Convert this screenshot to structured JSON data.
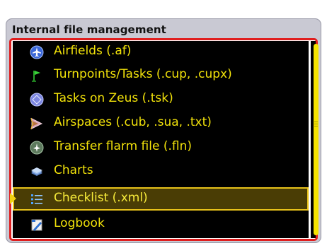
{
  "panel": {
    "title": "Internal file management"
  },
  "items": [
    {
      "label": "Airfields (.af)",
      "icon": "airfield-icon"
    },
    {
      "label": "Turnpoints/Tasks (.cup, .cupx)",
      "icon": "flag-icon"
    },
    {
      "label": "Tasks on Zeus (.tsk)",
      "icon": "task-icon"
    },
    {
      "label": "Airspaces (.cub, .sua, .txt)",
      "icon": "airspace-icon"
    },
    {
      "label": "Transfer flarm file (.fln)",
      "icon": "flarm-icon"
    },
    {
      "label": "Charts",
      "icon": "charts-icon"
    },
    {
      "label": "Checklist (.xml)",
      "icon": "checklist-icon",
      "selected": true
    },
    {
      "label": "Logbook",
      "icon": "logbook-icon"
    }
  ],
  "colors": {
    "text": "#f2e20a",
    "background": "#000000",
    "highlight_border": "#e01e1e",
    "selection_border": "#e8c21a"
  }
}
